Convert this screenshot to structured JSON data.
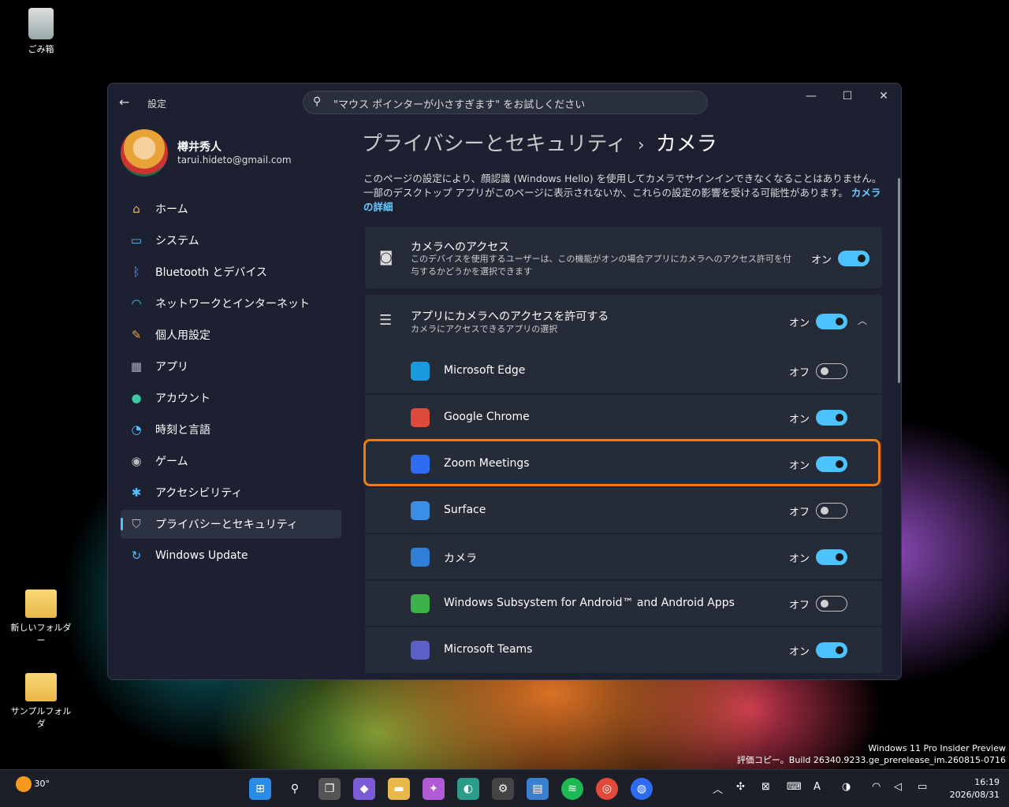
{
  "desktop": {
    "icons": [
      {
        "label": "ごみ箱"
      },
      {
        "label": "新しいフォルダー"
      },
      {
        "label": "サンプルフォルダ"
      }
    ],
    "watermark_line1": "Windows 11 Pro Insider Preview",
    "watermark_line2": "評価コピー。Build 26340.9233.ge_prerelease_im.260815-0716"
  },
  "window": {
    "title": "設定",
    "search_placeholder": "\"マウス ポインターが小さすぎます\" をお試しください",
    "controls": {
      "minimize": "—",
      "maximize": "☐",
      "close": "✕"
    }
  },
  "profile": {
    "name": "樽井秀人",
    "email": "tarui.hideto@gmail.com"
  },
  "sidebar": {
    "items": [
      {
        "label": "ホーム",
        "icon": "home-icon"
      },
      {
        "label": "システム",
        "icon": "monitor-icon"
      },
      {
        "label": "Bluetooth とデバイス",
        "icon": "bluetooth-icon"
      },
      {
        "label": "ネットワークとインターネット",
        "icon": "wifi-icon"
      },
      {
        "label": "個人用設定",
        "icon": "brush-icon"
      },
      {
        "label": "アプリ",
        "icon": "apps-icon"
      },
      {
        "label": "アカウント",
        "icon": "person-icon"
      },
      {
        "label": "時刻と言語",
        "icon": "clock-globe-icon"
      },
      {
        "label": "ゲーム",
        "icon": "gamepad-icon"
      },
      {
        "label": "アクセシビリティ",
        "icon": "accessibility-icon"
      },
      {
        "label": "プライバシーとセキュリティ",
        "icon": "shield-icon",
        "active": true
      },
      {
        "label": "Windows Update",
        "icon": "update-icon"
      }
    ]
  },
  "main": {
    "breadcrumb_parent": "プライバシーとセキュリティ",
    "breadcrumb_sep": "›",
    "breadcrumb_current": "カメラ",
    "description": "このページの設定により、顔認識 (Windows Hello) を使用してカメラでサインインできなくなることはありません。一部のデスクトップ アプリがこのページに表示されないか、これらの設定の影響を受ける可能性があります。",
    "description_link": "カメラの詳細",
    "camera_access": {
      "title": "カメラへのアクセス",
      "subtitle": "このデバイスを使用するユーザーは、この機能がオンの場合アプリにカメラへのアクセス許可を付与するかどうかを選択できます",
      "state": "オン"
    },
    "app_access": {
      "title": "アプリにカメラへのアクセスを許可する",
      "subtitle": "カメラにアクセスできるアプリの選択",
      "state": "オン"
    },
    "apps": [
      {
        "name": "Microsoft Edge",
        "state": "オフ",
        "on": false,
        "color": "#1a9be0"
      },
      {
        "name": "Google Chrome",
        "state": "オン",
        "on": true,
        "color": "#e04a3a"
      },
      {
        "name": "Zoom Meetings",
        "state": "オン",
        "on": true,
        "color": "#2d6cf0"
      },
      {
        "name": "Surface",
        "state": "オフ",
        "on": false,
        "color": "#3a8ee6"
      },
      {
        "name": "カメラ",
        "state": "オン",
        "on": true,
        "color": "#2f7fd8"
      },
      {
        "name": "Windows Subsystem for Android™ and Android Apps",
        "state": "オフ",
        "on": false,
        "color": "#3bb34a"
      },
      {
        "name": "Microsoft Teams",
        "state": "オン",
        "on": true,
        "color": "#5b5fc7"
      }
    ]
  },
  "taskbar": {
    "weather_temp": "30°",
    "time": "16:19",
    "date": "2026/08/31",
    "ime": "A"
  }
}
